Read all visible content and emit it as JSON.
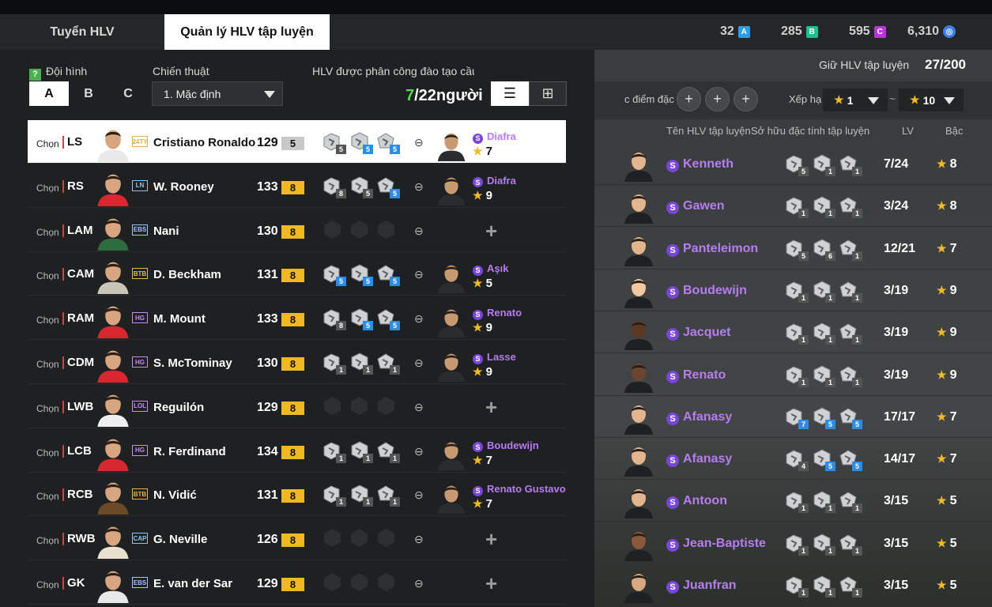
{
  "tabs": {
    "recruit": "Tuyển HLV",
    "manage": "Quản lý HLV tập luyện"
  },
  "currencies": [
    {
      "value": "32",
      "badge": "A",
      "color": "#2f9de6"
    },
    {
      "value": "285",
      "badge": "B",
      "color": "#1ec08b"
    },
    {
      "value": "595",
      "badge": "C",
      "color": "#b637d8"
    },
    {
      "value": "6,310",
      "badge": "FC",
      "color": "#3d7ee8"
    }
  ],
  "left": {
    "squad_label": "Đội hình",
    "squad_options": [
      "A",
      "B",
      "C"
    ],
    "tactic_label": "Chiến thuật",
    "tactic_value": "1. Mặc định",
    "assign_label": "HLV được phân công đào tạo cầu th",
    "assigned": "7",
    "assigned_rest": "/22người"
  },
  "players": [
    {
      "chon": "Chọn",
      "pos": "LS",
      "season": "24TY",
      "season_color": "#d9b04a",
      "name": "Cristiano Ronaldo",
      "ovr": "129",
      "level": "5",
      "level_style": "grey",
      "jersey": "#e8e8e8",
      "traits": [
        "5",
        "5",
        "5"
      ],
      "trait_blue": [
        false,
        true,
        true
      ],
      "coach": "Diafra",
      "coach_stars": "7",
      "selected": true
    },
    {
      "chon": "Chọn",
      "pos": "RS",
      "season": "LN",
      "season_color": "#8ec5f0",
      "name": "W. Rooney",
      "ovr": "133",
      "level": "8",
      "level_style": "",
      "jersey": "#d8272e",
      "traits": [
        "8",
        "5",
        "5"
      ],
      "trait_blue": [
        false,
        false,
        true
      ],
      "coach": "Diafra",
      "coach_stars": "9",
      "selected": false
    },
    {
      "chon": "Chọn",
      "pos": "LAM",
      "season": "EBS",
      "season_color": "#9fc4ff",
      "name": "Nani",
      "ovr": "130",
      "level": "8",
      "level_style": "",
      "jersey": "#2e6b3e",
      "traits": [],
      "trait_blue": [],
      "coach": "",
      "coach_stars": "",
      "selected": false
    },
    {
      "chon": "Chọn",
      "pos": "CAM",
      "season": "BTB",
      "season_color": "#e8b74a",
      "name": "D. Beckham",
      "ovr": "131",
      "level": "8",
      "level_style": "",
      "jersey": "#c9c6b8",
      "traits": [
        "5",
        "5",
        "5"
      ],
      "trait_blue": [
        true,
        true,
        true
      ],
      "coach": "Aşık",
      "coach_stars": "5",
      "selected": false
    },
    {
      "chon": "Chọn",
      "pos": "RAM",
      "season": "HG",
      "season_color": "#c58ef0",
      "name": "M. Mount",
      "ovr": "133",
      "level": "8",
      "level_style": "",
      "jersey": "#d8272e",
      "traits": [
        "8",
        "5",
        "5"
      ],
      "trait_blue": [
        false,
        true,
        true
      ],
      "coach": "Renato",
      "coach_stars": "9",
      "selected": false
    },
    {
      "chon": "Chọn",
      "pos": "CDM",
      "season": "HG",
      "season_color": "#c58ef0",
      "name": "S. McTominay",
      "ovr": "130",
      "level": "8",
      "level_style": "",
      "jersey": "#d8272e",
      "traits": [
        "1",
        "1",
        "1"
      ],
      "trait_blue": [
        false,
        false,
        false
      ],
      "coach": "Lasse",
      "coach_stars": "9",
      "selected": false
    },
    {
      "chon": "Chọn",
      "pos": "LWB",
      "season": "LOL",
      "season_color": "#c58ef0",
      "name": "Reguilón",
      "ovr": "129",
      "level": "8",
      "level_style": "",
      "jersey": "#f0f0f0",
      "traits": [],
      "trait_blue": [],
      "coach": "",
      "coach_stars": "",
      "selected": false
    },
    {
      "chon": "Chọn",
      "pos": "LCB",
      "season": "HG",
      "season_color": "#c58ef0",
      "name": "R. Ferdinand",
      "ovr": "134",
      "level": "8",
      "level_style": "",
      "jersey": "#d8272e",
      "traits": [
        "1",
        "1",
        "1"
      ],
      "trait_blue": [
        false,
        false,
        false
      ],
      "coach": "Boudewijn",
      "coach_stars": "7",
      "selected": false
    },
    {
      "chon": "Chọn",
      "pos": "RCB",
      "season": "BTB",
      "season_color": "#e8b74a",
      "name": "N. Vidić",
      "ovr": "131",
      "level": "8",
      "level_style": "",
      "jersey": "#6b4a2a",
      "traits": [
        "1",
        "1",
        "1"
      ],
      "trait_blue": [
        false,
        false,
        false
      ],
      "coach": "Renato Gustavo",
      "coach_stars": "7",
      "selected": false
    },
    {
      "chon": "Chọn",
      "pos": "RWB",
      "season": "CAP",
      "season_color": "#8ec5f0",
      "name": "G. Neville",
      "ovr": "126",
      "level": "8",
      "level_style": "",
      "jersey": "#e8e0d0",
      "traits": [],
      "trait_blue": [],
      "coach": "",
      "coach_stars": "",
      "selected": false
    },
    {
      "chon": "Chọn",
      "pos": "GK",
      "season": "EBS",
      "season_color": "#9fc4ff",
      "name": "E. van der Sar",
      "ovr": "129",
      "level": "8",
      "level_style": "",
      "jersey": "#e8e8e8",
      "traits": [],
      "trait_blue": [],
      "coach": "",
      "coach_stars": "",
      "selected": false
    }
  ],
  "right": {
    "title": "Giữ HLV tập luyện",
    "count": "27/200",
    "filter_label": "c điểm đặc",
    "rank_label": "Xếp hạ",
    "rank_from": "1",
    "rank_tilde": "~",
    "rank_to": "10",
    "col_name": "Tên HLV tập luyện",
    "col_traits": "Sở hữu đặc tính tập luyện",
    "col_lv": "LV",
    "col_rank": "Bậc",
    "coaches": [
      {
        "name": "Kenneth",
        "traits": [
          "5",
          "1",
          "1"
        ],
        "trait_blue": [
          false,
          false,
          false
        ],
        "lv": "7/24",
        "stars": "8",
        "skin": "#e3b58f"
      },
      {
        "name": "Gawen",
        "traits": [
          "1",
          "1",
          "1"
        ],
        "trait_blue": [
          false,
          false,
          false
        ],
        "lv": "3/24",
        "stars": "8",
        "skin": "#e3b58f"
      },
      {
        "name": "Panteleimon",
        "traits": [
          "5",
          "6",
          "1"
        ],
        "trait_blue": [
          false,
          false,
          false
        ],
        "lv": "12/21",
        "stars": "7",
        "skin": "#e3b58f"
      },
      {
        "name": "Boudewijn",
        "traits": [
          "1",
          "1",
          "1"
        ],
        "trait_blue": [
          false,
          false,
          false
        ],
        "lv": "3/19",
        "stars": "9",
        "skin": "#f0c9a0"
      },
      {
        "name": "Jacquet",
        "traits": [
          "1",
          "1",
          "1"
        ],
        "trait_blue": [
          false,
          false,
          false
        ],
        "lv": "3/19",
        "stars": "9",
        "skin": "#5a3a26"
      },
      {
        "name": "Renato",
        "traits": [
          "1",
          "1",
          "1"
        ],
        "trait_blue": [
          false,
          false,
          false
        ],
        "lv": "3/19",
        "stars": "9",
        "skin": "#6b4530"
      },
      {
        "name": "Afanasy",
        "traits": [
          "7",
          "5",
          "5"
        ],
        "trait_blue": [
          true,
          true,
          true
        ],
        "lv": "17/17",
        "stars": "7",
        "skin": "#e3b58f"
      },
      {
        "name": "Afanasy",
        "traits": [
          "4",
          "5",
          "5"
        ],
        "trait_blue": [
          false,
          true,
          true
        ],
        "lv": "14/17",
        "stars": "7",
        "skin": "#e3b58f"
      },
      {
        "name": "Antoon",
        "traits": [
          "1",
          "1",
          "1"
        ],
        "trait_blue": [
          false,
          false,
          false
        ],
        "lv": "3/15",
        "stars": "5",
        "skin": "#e3b58f"
      },
      {
        "name": "Jean-Baptiste",
        "traits": [
          "1",
          "1",
          "1"
        ],
        "trait_blue": [
          false,
          false,
          false
        ],
        "lv": "3/15",
        "stars": "5",
        "skin": "#8a5a3c"
      },
      {
        "name": "Juanfran",
        "traits": [
          "1",
          "1",
          "1"
        ],
        "trait_blue": [
          false,
          false,
          false
        ],
        "lv": "3/15",
        "stars": "5",
        "skin": "#d8a880"
      }
    ]
  }
}
